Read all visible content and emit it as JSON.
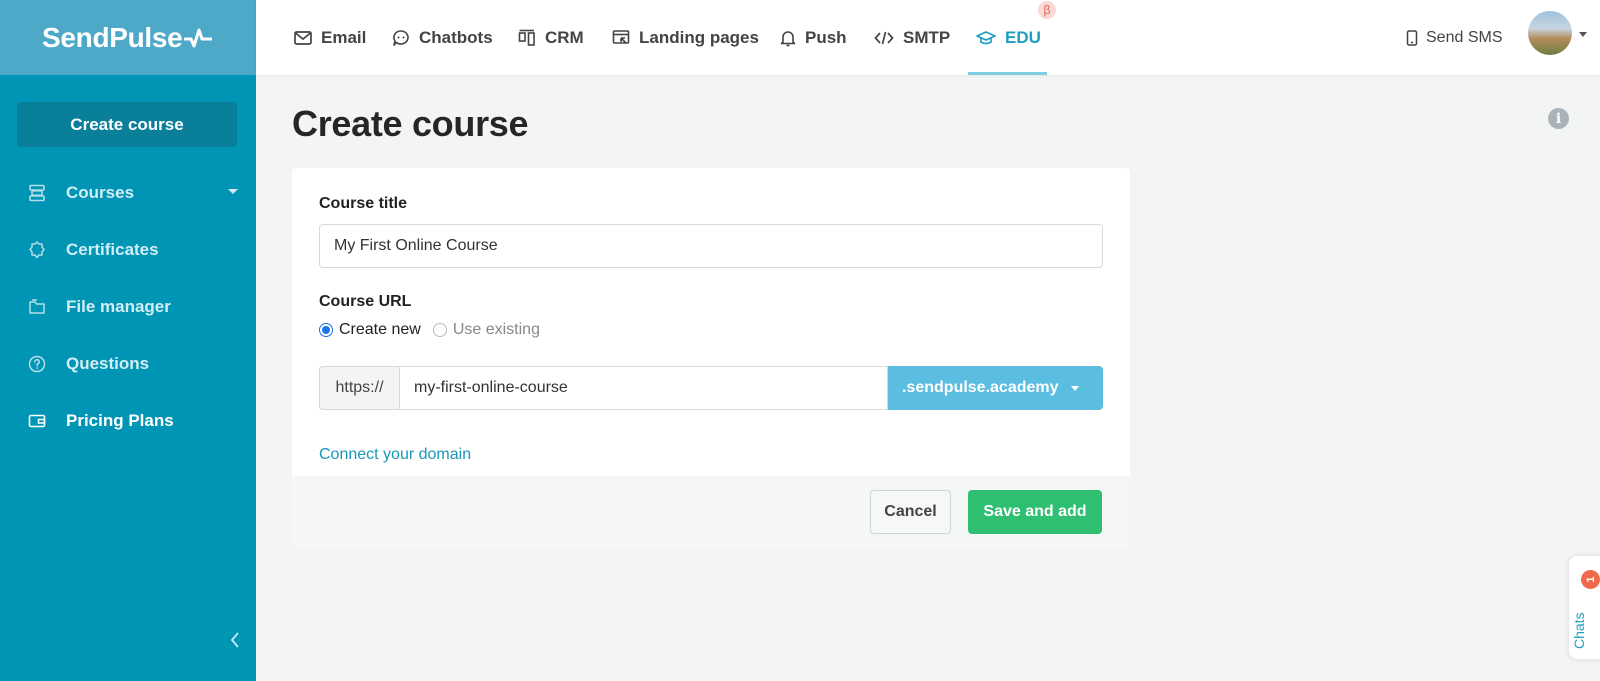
{
  "app": {
    "logo_text": "SendPulse"
  },
  "top_nav": {
    "tabs": [
      {
        "label": "Email",
        "icon": "envelope-icon"
      },
      {
        "label": "Chatbots",
        "icon": "chat-bubble-icon"
      },
      {
        "label": "CRM",
        "icon": "kanban-icon"
      },
      {
        "label": "Landing pages",
        "icon": "landing-page-icon"
      },
      {
        "label": "Push",
        "icon": "bell-icon"
      },
      {
        "label": "SMTP",
        "icon": "code-icon"
      },
      {
        "label": "EDU",
        "icon": "graduation-cap-icon",
        "active": true,
        "badge": "β"
      }
    ],
    "send_sms": "Send SMS"
  },
  "sidebar": {
    "create_button": "Create course",
    "items": [
      {
        "label": "Courses",
        "icon": "courses-icon",
        "has_dropdown": true
      },
      {
        "label": "Certificates",
        "icon": "certificate-icon"
      },
      {
        "label": "File manager",
        "icon": "folder-icon"
      },
      {
        "label": "Questions",
        "icon": "question-icon"
      },
      {
        "label": "Pricing Plans",
        "icon": "wallet-icon",
        "active": true
      }
    ]
  },
  "main": {
    "title": "Create course",
    "form": {
      "course_title_label": "Course title",
      "course_title_value": "My First Online Course",
      "course_url_label": "Course URL",
      "radio_create_new": "Create new",
      "radio_use_existing": "Use existing",
      "selected_option": "Create new",
      "url_prefix": "https://",
      "url_slug": "my-first-online-course",
      "url_domain": ".sendpulse.academy",
      "connect_domain_link": "Connect your domain",
      "cancel_button": "Cancel",
      "save_button": "Save and add"
    }
  },
  "chats_widget": {
    "label": "Chats",
    "badge_count": "1"
  },
  "colors": {
    "sidebar_bg": "#0095b4",
    "logo_bg": "#4ea8c8",
    "accent": "#1e9fc0",
    "save_green": "#2fbf71",
    "domain_blue": "#5bbddf"
  }
}
